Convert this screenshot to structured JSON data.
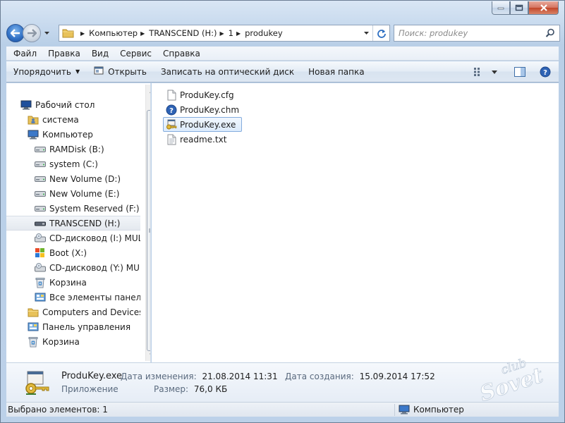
{
  "window": {
    "controls": [
      "minimize",
      "maximize",
      "close"
    ]
  },
  "address": {
    "crumbs": [
      "Компьютер",
      "TRANSCEND (H:)",
      "1",
      "produkey"
    ]
  },
  "search": {
    "placeholder": "Поиск: produkey"
  },
  "menu": [
    "Файл",
    "Правка",
    "Вид",
    "Сервис",
    "Справка"
  ],
  "toolbar": {
    "organize": "Упорядочить",
    "open": "Открыть",
    "burn": "Записать на оптический диск",
    "new_folder": "Новая папка"
  },
  "nav": {
    "items": [
      {
        "label": "Рабочий стол",
        "icon": "desktop-icon",
        "level": 0
      },
      {
        "label": "система",
        "icon": "user-folder-icon",
        "level": 1
      },
      {
        "label": "Компьютер",
        "icon": "computer-icon",
        "level": 1
      },
      {
        "label": "RAMDisk (B:)",
        "icon": "drive-icon",
        "level": 2
      },
      {
        "label": "system (C:)",
        "icon": "drive-icon",
        "level": 2
      },
      {
        "label": "New Volume (D:)",
        "icon": "drive-icon",
        "level": 2
      },
      {
        "label": "New Volume (E:)",
        "icon": "drive-icon",
        "level": 2
      },
      {
        "label": "System Reserved (F:)",
        "icon": "drive-icon",
        "level": 2
      },
      {
        "label": "TRANSCEND (H:)",
        "icon": "usb-drive-icon",
        "level": 2,
        "selected": true
      },
      {
        "label": "CD-дисковод (I:) MULTI",
        "icon": "cd-drive-icon",
        "level": 2
      },
      {
        "label": "Boot (X:)",
        "icon": "windows-drive-icon",
        "level": 2
      },
      {
        "label": "CD-дисковод (Y:) MULT",
        "icon": "cd-drive-icon",
        "level": 2
      },
      {
        "label": "Корзина",
        "icon": "recycle-bin-icon",
        "level": 2
      },
      {
        "label": "Все элементы панели у",
        "icon": "control-panel-icon",
        "level": 2
      },
      {
        "label": "Computers and Devices",
        "icon": "folder-icon",
        "level": 1
      },
      {
        "label": "Панель управления",
        "icon": "control-panel-icon",
        "level": 1
      },
      {
        "label": "Корзина",
        "icon": "recycle-bin-icon",
        "level": 1
      }
    ]
  },
  "files": [
    {
      "name": "ProduKey.cfg",
      "icon": "file-icon"
    },
    {
      "name": "ProduKey.chm",
      "icon": "help-file-icon"
    },
    {
      "name": "ProduKey.exe",
      "icon": "key-app-icon",
      "selected": true
    },
    {
      "name": "readme.txt",
      "icon": "text-file-icon"
    }
  ],
  "details": {
    "name": "ProduKey.exe",
    "type": "Приложение",
    "modified_label": "Дата изменения:",
    "modified_value": "21.08.2014 11:31",
    "size_label": "Размер:",
    "size_value": "76,0 КБ",
    "created_label": "Дата создания:",
    "created_value": "15.09.2014 17:52"
  },
  "status": {
    "selected": "Выбрано элементов: 1",
    "location": "Компьютер"
  },
  "watermark": "club Sovet"
}
